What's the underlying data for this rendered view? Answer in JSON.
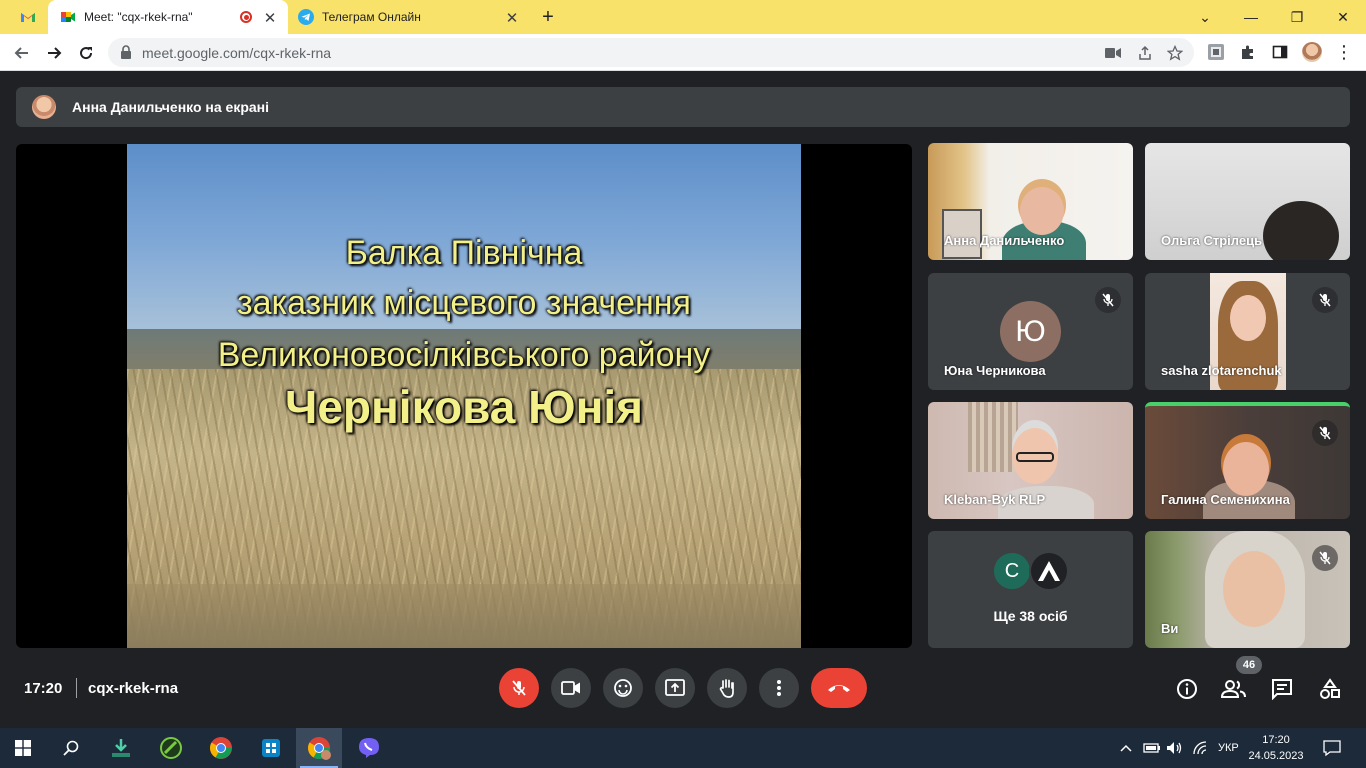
{
  "browser": {
    "tabs": [
      {
        "title": "",
        "icon": "gmail-icon"
      },
      {
        "title": "Meet: \"cqx-rkek-rna\"",
        "icon": "meet-icon",
        "active": true
      },
      {
        "title": "Телеграм Онлайн",
        "icon": "telegram-icon"
      }
    ],
    "url": "meet.google.com/cqx-rkek-rna"
  },
  "meet": {
    "presenting_text": "Анна Данильченко на екрані",
    "slide": {
      "line1": "Балка Північна",
      "line2": "заказник місцевого значення",
      "line3": "Великоновосілківського району",
      "line4": "Чернікова Юнія"
    },
    "participants": [
      {
        "name": "Анна Данильченко",
        "muted": false
      },
      {
        "name": "Ольга Стрілець",
        "muted": false
      },
      {
        "name": "Юна Черникова",
        "muted": true,
        "initial": "Ю"
      },
      {
        "name": "sasha zlotarenchuk",
        "muted": true
      },
      {
        "name": "Kleban-Byk RLP",
        "muted": false
      },
      {
        "name": "Галина Семенихина",
        "muted": true
      },
      {
        "more_label": "Ще 38 осіб",
        "avatars": [
          "С",
          "A"
        ]
      },
      {
        "name": "Ви",
        "muted": true
      }
    ],
    "bottom": {
      "time": "17:20",
      "meeting_code": "cqx-rkek-rna",
      "participants_count": "46"
    }
  },
  "taskbar": {
    "language": "УКР",
    "time": "17:20",
    "date": "24.05.2023"
  },
  "colors": {
    "tabstrip": "#f9e26a",
    "meet_bg": "#202124",
    "tile_bg": "#3c4043",
    "red": "#ea4335"
  }
}
